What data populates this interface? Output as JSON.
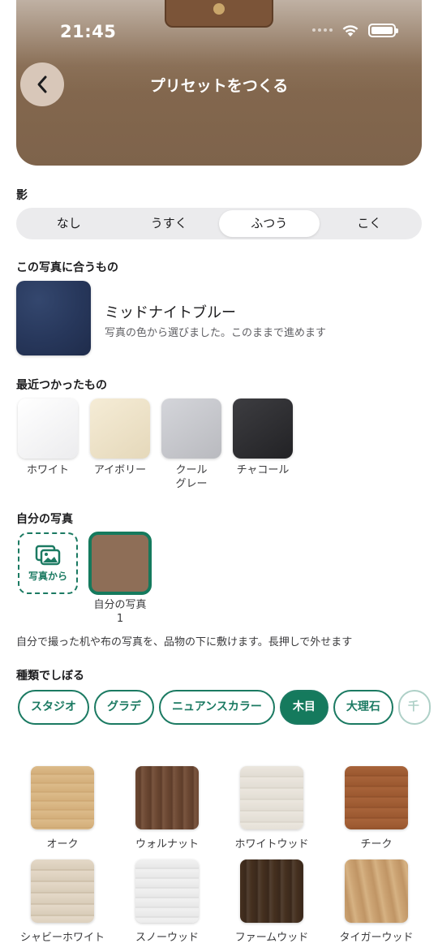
{
  "status": {
    "time": "21:45"
  },
  "header": {
    "title": "プリセットをつくる"
  },
  "shadow": {
    "label": "影",
    "options": [
      "なし",
      "うすく",
      "ふつう",
      "こく"
    ],
    "selected": "ふつう"
  },
  "match": {
    "label": "この写真に合うもの",
    "name": "ミッドナイトブルー",
    "description": "写真の色から選びました。このままで進めます",
    "color": "#27375b"
  },
  "recent": {
    "label": "最近つかったもの",
    "items": [
      {
        "name": "ホワイト",
        "color": "#f4f4f4"
      },
      {
        "name": "アイボリー",
        "color": "#ede2c9"
      },
      {
        "name": "クール\nグレー",
        "line1": "クール",
        "line2": "グレー",
        "color": "#c4c5ca"
      },
      {
        "name": "チャコール",
        "color": "#2e2e31"
      }
    ]
  },
  "my_photos": {
    "label": "自分の写真",
    "add_label": "写真から",
    "photo_name_line1": "自分の写真",
    "photo_name_line2": "1",
    "photo_color": "#8e6e57",
    "note": "自分で撮った机や布の写真を、品物の下に敷けます。長押しで外せます"
  },
  "filter": {
    "label": "種類でしぼる",
    "chips": [
      "スタジオ",
      "グラデ",
      "ニュアンスカラー",
      "木目",
      "大理石",
      "千"
    ],
    "selected": "木目"
  },
  "woods": [
    {
      "name": "オーク",
      "color": "#d9b685"
    },
    {
      "name": "ウォルナット",
      "color": "#6a4631"
    },
    {
      "name": "ホワイトウッド",
      "color": "#e9e4dc"
    },
    {
      "name": "チーク",
      "color": "#a45f33"
    },
    {
      "name": "シャビーホワイト",
      "color": "#e2d7c5"
    },
    {
      "name": "スノーウッド",
      "color": "#eeeeee"
    },
    {
      "name": "ファームウッド",
      "color": "#3f2b20"
    },
    {
      "name": "タイガーウッド",
      "color": "#c99e6d"
    }
  ],
  "colors": {
    "accent": "#157a5d"
  }
}
